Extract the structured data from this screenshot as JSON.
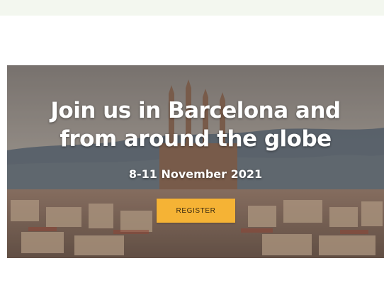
{
  "hero": {
    "headline_line1": "Join us in Barcelona and",
    "headline_line2": "from around the globe",
    "dates": "8-11 November 2021",
    "register_label": "REGISTER"
  },
  "colors": {
    "page_bg": "#f3f7ef",
    "button_bg": "#f5b335",
    "text": "#ffffff"
  }
}
